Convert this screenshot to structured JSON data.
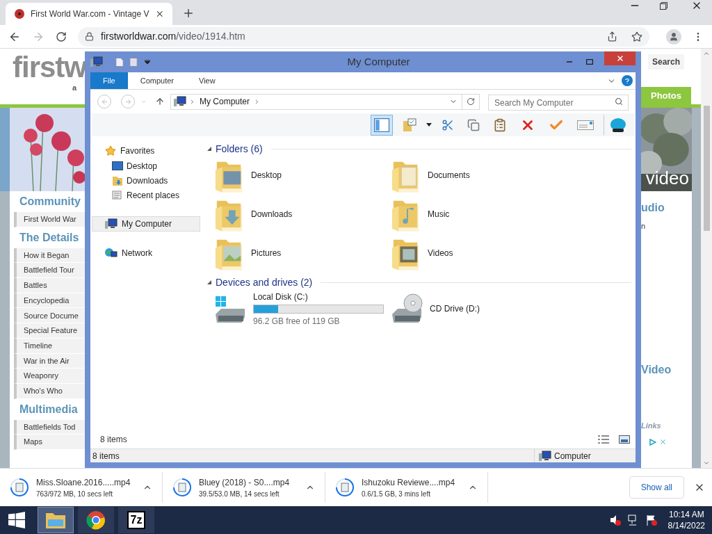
{
  "browser": {
    "tab": {
      "title": "First World War.com - Vintage V",
      "selected": true
    },
    "back": {
      "disabled": false
    },
    "forward": {
      "disabled": true
    },
    "url": {
      "host": "firstworldwar.com",
      "path": "/video/1914.htm"
    }
  },
  "web_page": {
    "logo": "firstw",
    "tagline": "a",
    "search_button": "Search",
    "photos_tab": "Photos",
    "video_label": "video",
    "sidebar": [
      {
        "heading": "Community",
        "items": [
          "First World War"
        ]
      },
      {
        "heading": "The Details",
        "items": [
          "How it Began",
          "Battlefield Tour",
          "Battles",
          "Encyclopedia",
          "Source Docume",
          "Special Feature",
          "Timeline",
          "War in the Air",
          "Weaponry",
          "Who's Who"
        ]
      },
      {
        "heading": "Multimedia",
        "items": [
          "Battlefields Tod",
          "Maps"
        ]
      }
    ],
    "right": {
      "audio_heading": "udio",
      "audio_text": "n",
      "video_heading": "Video",
      "links_heading": "Links"
    }
  },
  "explorer": {
    "title": "My Computer",
    "ribbon_tabs": [
      {
        "label": "File",
        "selected": true
      },
      {
        "label": "Computer",
        "selected": false
      },
      {
        "label": "View",
        "selected": false
      }
    ],
    "breadcrumb": "My Computer",
    "search_placeholder": "Search My Computer",
    "toolbar": [
      {
        "kind": "layout",
        "selected": true
      },
      {
        "kind": "properties",
        "selected": false
      },
      {
        "kind": "caret",
        "selected": false
      },
      {
        "kind": "cut",
        "selected": false
      },
      {
        "kind": "copy",
        "selected": false
      },
      {
        "kind": "paste",
        "selected": false
      },
      {
        "kind": "delete",
        "selected": false
      },
      {
        "kind": "check",
        "selected": false
      },
      {
        "kind": "rename",
        "selected": false
      },
      {
        "kind": "shell",
        "selected": false
      }
    ],
    "nav": [
      {
        "label": "Favorites",
        "kind": "star",
        "selected": false,
        "children": [
          {
            "label": "Desktop",
            "kind": "desktop",
            "selected": false
          },
          {
            "label": "Downloads",
            "kind": "downloads",
            "selected": false
          },
          {
            "label": "Recent places",
            "kind": "recent",
            "selected": false
          }
        ]
      },
      {
        "label": "My Computer",
        "kind": "computer",
        "selected": true
      },
      {
        "label": "Network",
        "kind": "network",
        "selected": false
      }
    ],
    "groups": [
      {
        "title": "Folders (6)",
        "expanded": true,
        "items": [
          {
            "kind": "folder",
            "name": "Desktop"
          },
          {
            "kind": "folder",
            "name": "Documents"
          },
          {
            "kind": "folder",
            "name": "Downloads"
          },
          {
            "kind": "folder",
            "name": "Music"
          },
          {
            "kind": "folder",
            "name": "Pictures"
          },
          {
            "kind": "folder",
            "name": "Videos"
          }
        ]
      },
      {
        "title": "Devices and drives (2)",
        "expanded": true,
        "items": [
          {
            "kind": "disk",
            "name": "Local Disk (C:)",
            "level": 0.19,
            "detail": "96.2 GB free of 119 GB"
          },
          {
            "kind": "optical",
            "name": "CD Drive (D:)"
          }
        ]
      }
    ],
    "item_count": "8 items",
    "status_bar": {
      "count": "8 items",
      "location": "Computer"
    }
  },
  "downloads": {
    "items": [
      {
        "name": "Miss.Sloane.2016.....mp4",
        "status": "763/972 MB, 10 secs left"
      },
      {
        "name": "Bluey (2018) - S0....mp4",
        "status": "39.5/53.0 MB, 14 secs left"
      },
      {
        "name": "Ishuzoku Reviewe....mp4",
        "status": "0.6/1.5 GB, 3 mins left"
      }
    ],
    "show_all": "Show all"
  },
  "taskbar": {
    "apps": [
      {
        "kind": "explorer",
        "selected": true
      },
      {
        "kind": "chrome",
        "selected": false
      },
      {
        "kind": "archiver",
        "label": "7z",
        "selected": false
      }
    ],
    "time": "10:14 AM",
    "date": "8/14/2022"
  }
}
